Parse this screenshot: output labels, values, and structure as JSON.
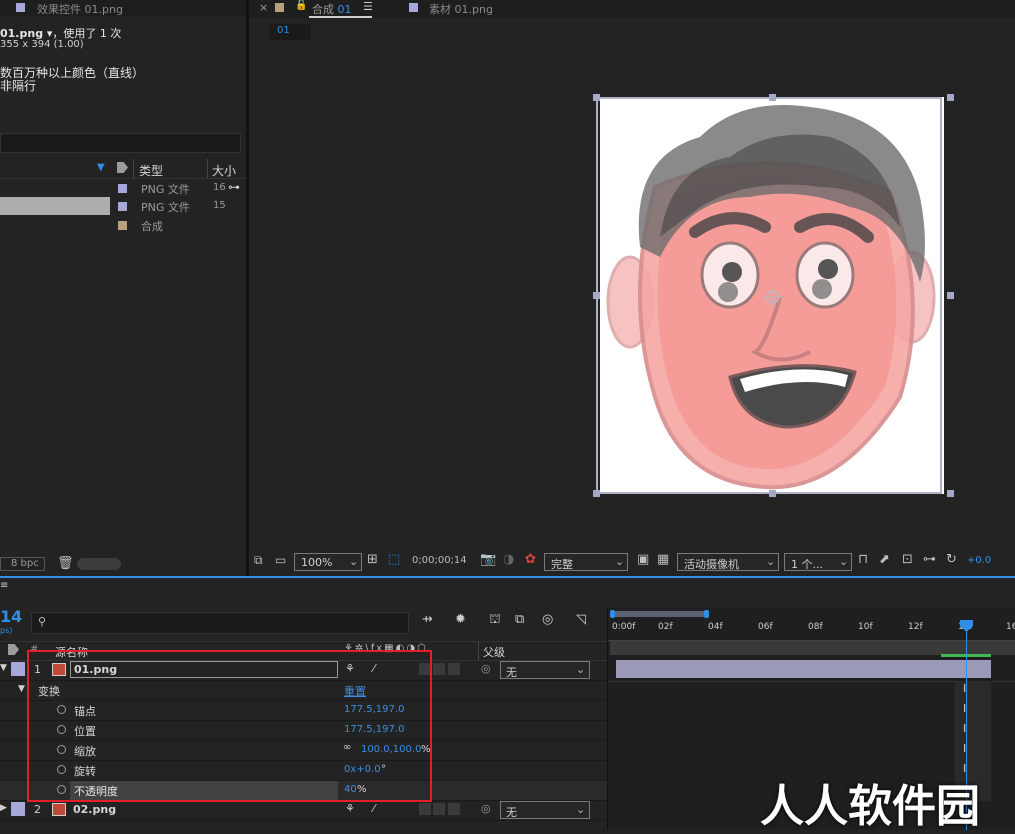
{
  "project": {
    "effects_tab": "效果控件 01.png",
    "file_name": "01.png ▾",
    "used_text": "，使用了 1 次",
    "dims": "355 x 394 (1.00)",
    "colors": "数百万种以上颜色（直线）",
    "interlace": "非隔行",
    "col_type": "类型",
    "col_size": "大小",
    "items": [
      {
        "type": "PNG 文件",
        "size": "16",
        "color": "#a5a8d8"
      },
      {
        "type": "PNG 文件",
        "size": "15",
        "color": "#a5a8d8"
      },
      {
        "type": "合成",
        "size": "",
        "color": "#b8a07c"
      }
    ],
    "bpc": "8 bpc"
  },
  "viewer": {
    "comp_tab": "合成",
    "comp_name": "01",
    "footage_tab": "素材 01.png",
    "breadcrumb": "01",
    "zoom": "100%",
    "timecode": "0;00;00;14",
    "quality": "完整",
    "camera": "活动摄像机",
    "views": "1 个...",
    "exposure": "+0.0"
  },
  "timeline": {
    "current_time": "14",
    "fps": "ps)",
    "search_placeholder": "",
    "col_source": "源名称",
    "col_parent": "父级",
    "ruler": [
      "0:00f",
      "02f",
      "04f",
      "06f",
      "08f",
      "10f",
      "12f",
      "14f",
      "16"
    ],
    "layers": [
      {
        "num": "1",
        "name": "01.png",
        "parent": "无"
      },
      {
        "num": "2",
        "name": "02.png",
        "parent": "无"
      }
    ],
    "transform": "变换",
    "reset": "重置",
    "props": [
      {
        "name": "锚点",
        "value": "177.5,197.0"
      },
      {
        "name": "位置",
        "value": "177.5,197.0"
      },
      {
        "name": "缩放",
        "value": "100.0,100.0",
        "unit": "%"
      },
      {
        "name": "旋转",
        "value": "0x+0.0",
        "unit": "°"
      },
      {
        "name": "不透明度",
        "value": "40",
        "unit": "%"
      }
    ]
  },
  "watermark": "人人软件园",
  "accent": "#2f8fe6",
  "highlight_box": "#e0202a"
}
